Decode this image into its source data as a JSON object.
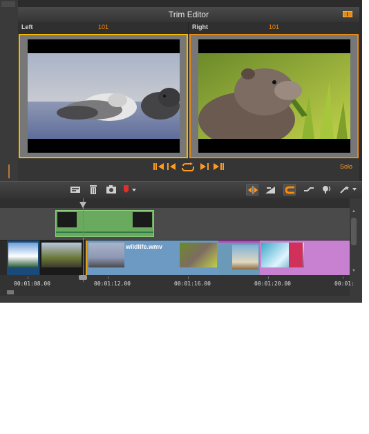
{
  "trim_editor": {
    "title": "Trim Editor",
    "left": {
      "label": "Left",
      "frame": "101"
    },
    "right": {
      "label": "Right",
      "frame": "101"
    },
    "solo_label": "Solo"
  },
  "timeline": {
    "clip_label": "wildlife.wmv",
    "timecodes": [
      "00:01:08.00",
      "00:01:12.00",
      "00:01:16.00",
      "00:01:20.00",
      "00:01:"
    ]
  },
  "colors": {
    "accent": "#ff8a00",
    "left_selection": "#f5b800",
    "right_selection": "#e98a14",
    "green_clip": "#6aaa5e",
    "blue_clip": "#6d9ac2",
    "purple_clip": "#c880d0"
  },
  "icons": {
    "toolbar": [
      "title-icon",
      "trash-icon",
      "camera-icon",
      "marker-icon",
      "split-icon",
      "speed-icon",
      "magnet-icon",
      "transition-icon",
      "audio-icon",
      "effects-icon"
    ],
    "trim_controls": [
      "skip-back-icon",
      "step-back-icon",
      "loop-icon",
      "step-forward-icon",
      "skip-forward-icon"
    ]
  }
}
